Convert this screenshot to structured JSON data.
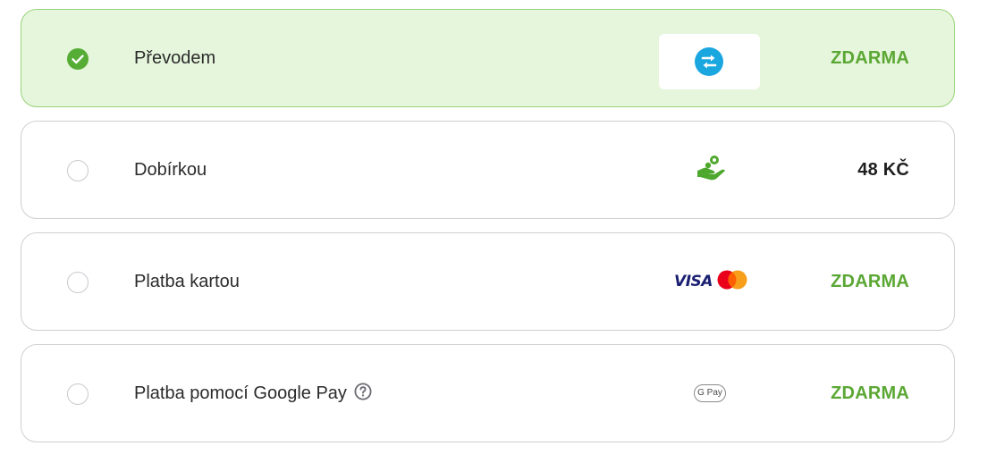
{
  "payment_methods": [
    {
      "label": "Převodem",
      "price": "ZDARMA",
      "selected": true,
      "icon": "bank-transfer-icon"
    },
    {
      "label": "Dobírkou",
      "price": "48 KČ",
      "selected": false,
      "icon": "cash-on-delivery-icon"
    },
    {
      "label": "Platba kartou",
      "price": "ZDARMA",
      "selected": false,
      "icon": "card-logos-icon",
      "card_brand": "VISA"
    },
    {
      "label": "Platba pomocí Google Pay",
      "price": "ZDARMA",
      "selected": false,
      "icon": "google-pay-icon",
      "badge_text": "G Pay"
    }
  ],
  "colors": {
    "accent_green": "#5ba734",
    "selected_bg": "#e6f6dc",
    "selected_border": "#98d278",
    "transfer_blue": "#1aa7e0",
    "visa_blue": "#1a1f71",
    "mastercard_red": "#eb001b",
    "mastercard_orange": "#f79e1b"
  }
}
